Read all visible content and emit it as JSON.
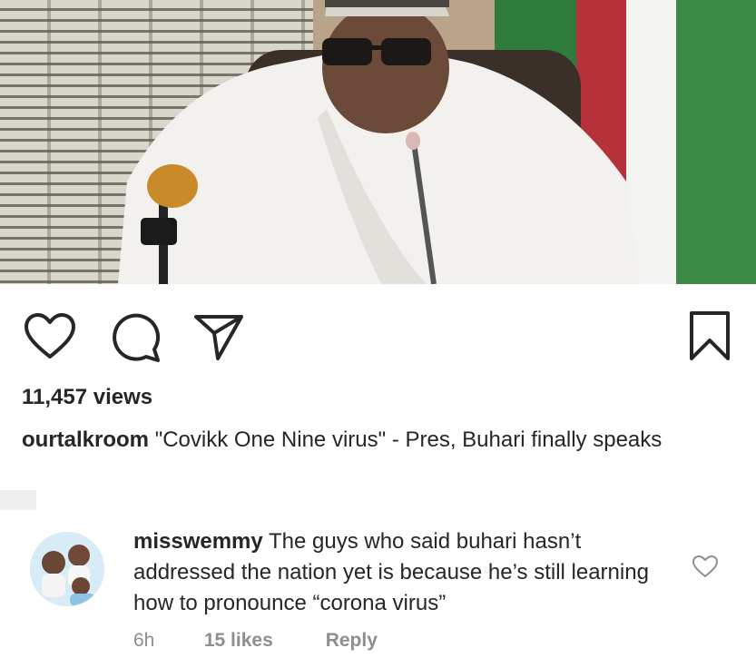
{
  "media": {
    "description_icon": "video-frame"
  },
  "actions": {
    "like_icon": "heart-icon",
    "comment_icon": "comment-icon",
    "share_icon": "send-icon",
    "save_icon": "bookmark-icon"
  },
  "post": {
    "views": "11,457 views",
    "username": "ourtalkroom",
    "caption": "\"Covikk One Nine virus\" - Pres, Buhari finally speaks"
  },
  "comment": {
    "username": "misswemmy",
    "text": "The guys who said buhari hasn’t addressed the nation yet is because he’s still learning how to pronounce “corona virus”",
    "time": "6h",
    "likes": "15 likes",
    "reply": "Reply"
  },
  "colors": {
    "text": "#262626",
    "muted": "#8e8e8e",
    "background": "#ffffff"
  }
}
